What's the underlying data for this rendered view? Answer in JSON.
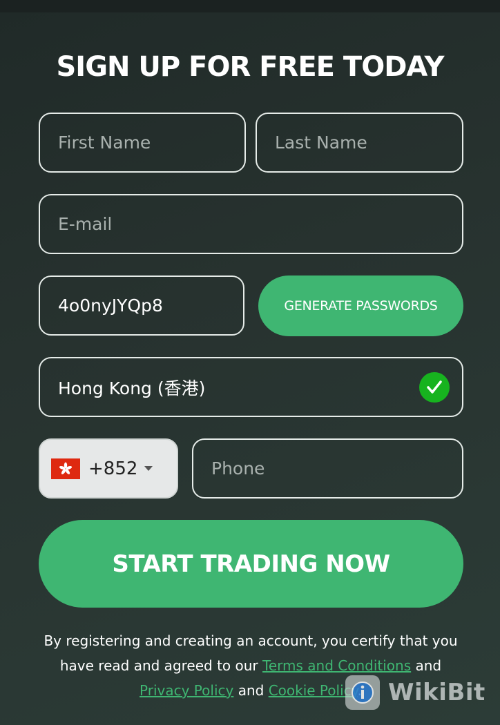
{
  "form": {
    "title": "SIGN UP FOR FREE TODAY",
    "first_name": {
      "placeholder": "First Name",
      "value": ""
    },
    "last_name": {
      "placeholder": "Last Name",
      "value": ""
    },
    "email": {
      "placeholder": "E-mail",
      "value": ""
    },
    "password": {
      "value": "4o0nyJYQp8"
    },
    "generate_label": "GENERATE PASSWORDS",
    "country": {
      "value": "Hong Kong (香港)",
      "status_icon": "check-circle-icon",
      "status_color": "#17b31f"
    },
    "dial": {
      "flag": "hong-kong-flag",
      "code": "+852"
    },
    "phone": {
      "placeholder": "Phone",
      "value": ""
    },
    "submit_label": "START TRADING NOW",
    "legal": {
      "part1": "By registering and creating an account, you certify that you have read and agreed to our ",
      "terms_link": "Terms and Conditions",
      "part2": " and ",
      "privacy_link": "Privacy Policy",
      "part3": " and ",
      "cookie_link": "Cookie Policy",
      "part4": "."
    }
  },
  "watermark": {
    "text": "WikiBit"
  },
  "colors": {
    "accent": "#3fb672",
    "background": "#27322f",
    "check": "#17b31f"
  }
}
